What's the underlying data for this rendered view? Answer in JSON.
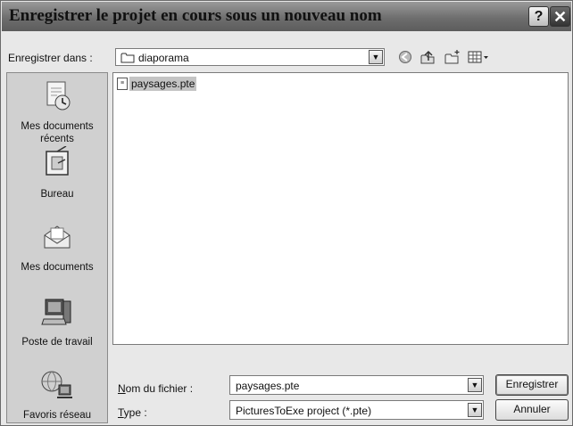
{
  "window": {
    "title": "Enregistrer le projet en cours sous un nouveau nom",
    "help_glyph": "?",
    "close_glyph": "✕"
  },
  "save_in": {
    "label": "Enregistrer dans :",
    "value": "diaporama"
  },
  "toolbar": {
    "icons": [
      "back-icon",
      "up-folder-icon",
      "new-folder-icon",
      "views-menu-icon"
    ]
  },
  "places": [
    {
      "label": "Mes documents récents",
      "icon": "recent-documents-icon"
    },
    {
      "label": "Bureau",
      "icon": "desktop-icon"
    },
    {
      "label": "Mes documents",
      "icon": "my-documents-icon"
    },
    {
      "label": "Poste de travail",
      "icon": "my-computer-icon"
    },
    {
      "label": "Favoris réseau",
      "icon": "network-places-icon"
    }
  ],
  "files": [
    {
      "name": "paysages.pte",
      "icon": "pte-file-icon",
      "selected": true
    }
  ],
  "filename": {
    "label": "Nom du fichier :",
    "value": "paysages.pte"
  },
  "filetype": {
    "label": "Type :",
    "value": "PicturesToExe project (*.pte)"
  },
  "buttons": {
    "save": "Enregistrer",
    "cancel": "Annuler"
  },
  "dropdown_glyph": "▼",
  "file_badge": "≡"
}
